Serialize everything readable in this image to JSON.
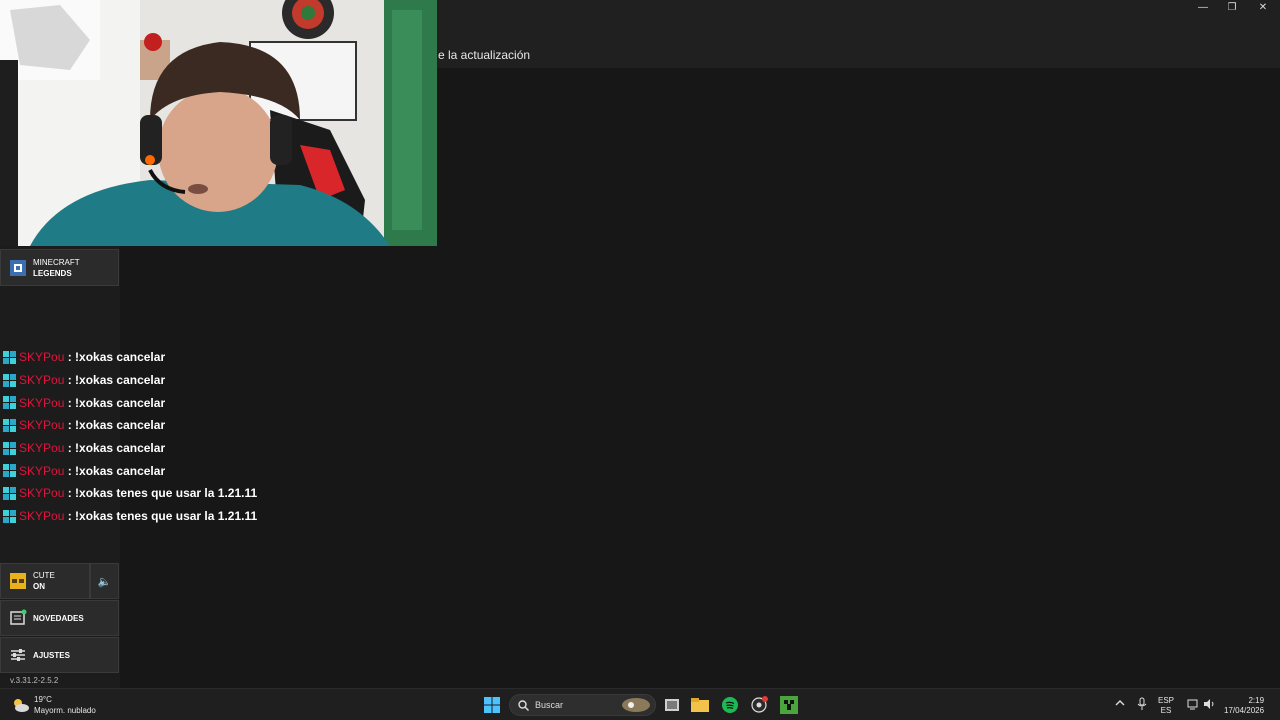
{
  "window": {
    "notice": "e la actualización",
    "controls": {
      "minimize": "—",
      "restore": "❐",
      "close": "✕"
    }
  },
  "launcher": {
    "game": {
      "line1": "MINECRAFT",
      "line2": "LEGENDS"
    },
    "cute": {
      "line1": "CUTE",
      "line2": "ON"
    },
    "sound_icon": "🔈",
    "news_label": "NOVEDADES",
    "settings_label": "AJUSTES",
    "version": "v.3.31.2-2.5.2"
  },
  "chat": {
    "messages": [
      {
        "user": "SKYPou",
        "text": ": !xokas cancelar"
      },
      {
        "user": "SKYPou",
        "text": ": !xokas cancelar"
      },
      {
        "user": "SKYPou",
        "text": ": !xokas cancelar"
      },
      {
        "user": "SKYPou",
        "text": ": !xokas cancelar"
      },
      {
        "user": "SKYPou",
        "text": ": !xokas cancelar"
      },
      {
        "user": "SKYPou",
        "text": ": !xokas cancelar"
      },
      {
        "user": "SKYPou",
        "text": ": !xokas tenes que usar la 1.21.11"
      },
      {
        "user": "SKYPou",
        "text": ": !xokas tenes que usar la 1.21.11"
      }
    ]
  },
  "taskbar": {
    "weather": {
      "temp": "19°C",
      "desc": "Mayorm. nublado"
    },
    "search_placeholder": "Buscar",
    "lang": {
      "top": "ESP",
      "bottom": "ES"
    },
    "clock": {
      "time": "2:19",
      "date": "17/04/2026"
    }
  },
  "colors": {
    "username": "#e0143c",
    "badge": "#3fd1d8",
    "background": "#171717"
  }
}
